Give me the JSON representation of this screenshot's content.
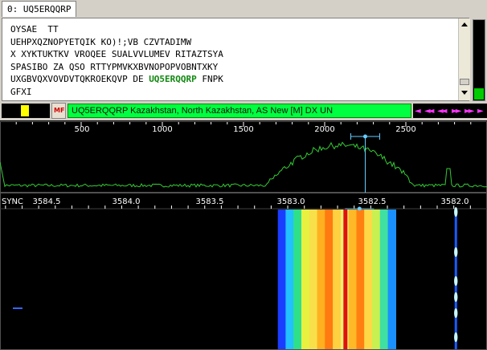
{
  "tab": {
    "label": "0: UQ5ERQQRP"
  },
  "text_lines": [
    "OYSAE  TT",
    "UEHPXQZNOPYETQIK KO)!;VB CZVTADIMW",
    "X XYKTUKTKV VROQEE SUALVVLUMEV RITAZTSYA",
    "SPASIBO ZA QSO RTTYPMVKXBVNOPOPVOBNTXKY",
    "GFXI"
  ],
  "line4": {
    "before": "UXGBVQXVOVDVTQKROEKQVP DE ",
    "callsign": "UQ5ERQQRP",
    "after": " FNPK"
  },
  "info_bar": {
    "text": "UQ5ERQQRP Kazakhstan, North Kazakhstan, AS New [M] DX UN"
  },
  "rs_badge": "MF",
  "level_meter": {
    "fraction": 0.14,
    "color": "#00cc00"
  },
  "nav": {
    "left1": "◄",
    "left2": "◄◄",
    "left3": "◄◄",
    "right1": "►►",
    "right2": "►►",
    "right3": "►"
  },
  "spectrum": {
    "axis_labels": [
      "500",
      "1000",
      "1500",
      "2000",
      "2500"
    ],
    "axis_values": [
      500,
      1000,
      1500,
      2000,
      2500
    ],
    "hz_range": [
      0,
      3000
    ],
    "marker_hz": 2250,
    "trace_color": "#33cc33",
    "marker_color": "#66ccff"
  },
  "waterfall": {
    "sync_label": "SYNC",
    "freq_labels": [
      "3584.5",
      "3584.0",
      "3583.5",
      "3583.0",
      "3582.5",
      "3582.0"
    ],
    "freq_values": [
      3584.5,
      3584.0,
      3583.5,
      3583.0,
      3582.5,
      3582.0
    ],
    "freq_range": [
      3584.733,
      3581.8
    ],
    "signal_band": [
      3583.06,
      3582.35
    ],
    "carrier_freq": 3582.655,
    "side_tone_freq": 3581.99
  }
}
